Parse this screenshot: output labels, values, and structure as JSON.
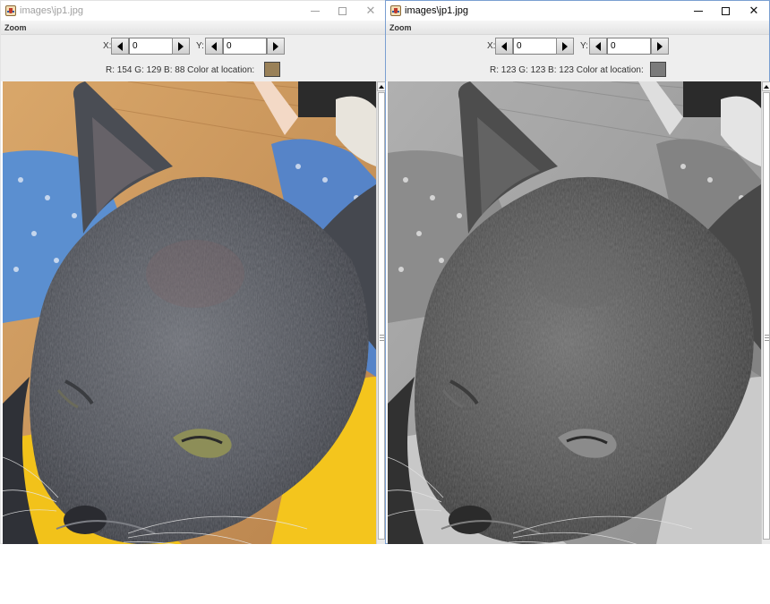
{
  "windows": [
    {
      "title": "images\\jp1.jpg",
      "menu": [
        "Zoom"
      ],
      "x_label": "X:",
      "x_value": "0",
      "y_label": "Y:",
      "y_value": "0",
      "rgb_text": "R: 154 G: 129 B: 88 Color at location:",
      "swatch_color": "#9a8158",
      "image": "cat-photo-color"
    },
    {
      "title": "images\\jp1.jpg",
      "menu": [
        "Zoom"
      ],
      "x_label": "X:",
      "x_value": "0",
      "y_label": "Y:",
      "y_value": "0",
      "rgb_text": "R: 123 G: 123 B: 123 Color at location:",
      "swatch_color": "#7b7b7b",
      "image": "cat-photo-grayscale"
    }
  ]
}
